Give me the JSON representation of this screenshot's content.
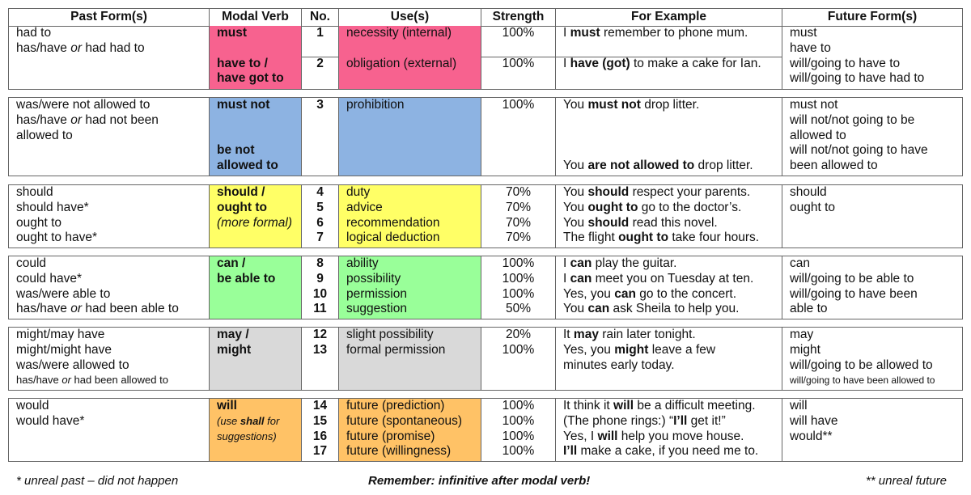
{
  "headers": [
    "Past Form(s)",
    "Modal Verb",
    "No.",
    "Use(s)",
    "Strength",
    "For Example",
    "Future Form(s)"
  ],
  "colors": {
    "must": "#f7628f",
    "must_not": "#8db3e2",
    "should": "#ffff66",
    "can": "#99ff99",
    "may": "#d9d9d9",
    "will": "#ffc266"
  },
  "groups": [
    {
      "color": "#f7628f",
      "lines": 4,
      "split_after": 2,
      "cells": {
        "past": [
          "had to",
          [
            {
              "t": "has/have "
            },
            {
              "t": "or",
              "s": "i"
            },
            {
              "t": " had had to"
            }
          ]
        ],
        "modal": [
          [
            {
              "t": "must",
              "s": "b"
            }
          ],
          "",
          [
            {
              "t": "have to /",
              "s": "b"
            }
          ],
          [
            {
              "t": "have got to",
              "s": "b"
            }
          ]
        ],
        "no": [
          [
            {
              "t": "1",
              "s": "b"
            }
          ],
          "",
          [
            {
              "t": "2",
              "s": "b"
            }
          ]
        ],
        "use": [
          "necessity (internal)",
          "",
          "obligation (external)"
        ],
        "strength": [
          "100%",
          "",
          "100%"
        ],
        "example": [
          [
            {
              "t": "I "
            },
            {
              "t": "must",
              "s": "b"
            },
            {
              "t": " remember to phone mum."
            }
          ],
          "",
          [
            {
              "t": "I "
            },
            {
              "t": "have (got)",
              "s": "b"
            },
            {
              "t": " to make a cake for Ian."
            }
          ]
        ],
        "future": [
          "must",
          "have to",
          "will/going to have to",
          "will/going to have had to"
        ]
      }
    },
    {
      "color": "#8db3e2",
      "lines": 5,
      "cells": {
        "past": [
          "was/were not allowed to",
          [
            {
              "t": "has/have "
            },
            {
              "t": "or",
              "s": "i"
            },
            {
              "t": " had not been"
            }
          ],
          "allowed to"
        ],
        "modal": [
          [
            {
              "t": "must not",
              "s": "b"
            }
          ],
          "",
          "",
          [
            {
              "t": "be not",
              "s": "b"
            }
          ],
          [
            {
              "t": "allowed to",
              "s": "b"
            }
          ]
        ],
        "no": [
          [
            {
              "t": "3",
              "s": "b"
            }
          ]
        ],
        "use": [
          "prohibition"
        ],
        "strength": [
          "100%"
        ],
        "example": [
          [
            {
              "t": "You "
            },
            {
              "t": "must not",
              "s": "b"
            },
            {
              "t": " drop litter."
            }
          ],
          "",
          "",
          "",
          [
            {
              "t": "You "
            },
            {
              "t": "are not allowed to",
              "s": "b"
            },
            {
              "t": " drop litter."
            }
          ]
        ],
        "future": [
          "must not",
          "will not/not going to be",
          "allowed to",
          "will not/not going to have",
          "been allowed to"
        ]
      }
    },
    {
      "color": "#ffff66",
      "lines": 4,
      "cells": {
        "past": [
          "should",
          "should have*",
          "ought to",
          "ought to have*"
        ],
        "modal": [
          [
            {
              "t": "should /",
              "s": "b"
            }
          ],
          [
            {
              "t": "ought to",
              "s": "b"
            }
          ],
          [
            {
              "t": "(more formal)",
              "s": "i"
            }
          ]
        ],
        "no": [
          [
            {
              "t": "4",
              "s": "b"
            }
          ],
          [
            {
              "t": "5",
              "s": "b"
            }
          ],
          [
            {
              "t": "6",
              "s": "b"
            }
          ],
          [
            {
              "t": "7",
              "s": "b"
            }
          ]
        ],
        "use": [
          "duty",
          "advice",
          "recommendation",
          "logical deduction"
        ],
        "strength": [
          "70%",
          "70%",
          "70%",
          "70%"
        ],
        "example": [
          [
            {
              "t": "You "
            },
            {
              "t": "should",
              "s": "b"
            },
            {
              "t": " respect your parents."
            }
          ],
          [
            {
              "t": "You "
            },
            {
              "t": "ought to",
              "s": "b"
            },
            {
              "t": " go to the doctor’s."
            }
          ],
          [
            {
              "t": "You "
            },
            {
              "t": "should",
              "s": "b"
            },
            {
              "t": " read this novel."
            }
          ],
          [
            {
              "t": "The flight "
            },
            {
              "t": "ought to",
              "s": "b"
            },
            {
              "t": " take four hours."
            }
          ]
        ],
        "future": [
          "should",
          "ought to"
        ]
      }
    },
    {
      "color": "#99ff99",
      "lines": 4,
      "cells": {
        "past": [
          "could",
          "could have*",
          "was/were able to",
          [
            {
              "t": "has/have "
            },
            {
              "t": "or",
              "s": "i"
            },
            {
              "t": " had been able to"
            }
          ]
        ],
        "modal": [
          [
            {
              "t": "can /",
              "s": "b"
            }
          ],
          [
            {
              "t": "be able to",
              "s": "b"
            }
          ]
        ],
        "no": [
          [
            {
              "t": "8",
              "s": "b"
            }
          ],
          [
            {
              "t": "9",
              "s": "b"
            }
          ],
          [
            {
              "t": "10",
              "s": "b"
            }
          ],
          [
            {
              "t": "11",
              "s": "b"
            }
          ]
        ],
        "use": [
          "ability",
          "possibility",
          "permission",
          "suggestion"
        ],
        "strength": [
          "100%",
          "100%",
          "100%",
          "50%"
        ],
        "example": [
          [
            {
              "t": "I "
            },
            {
              "t": "can",
              "s": "b"
            },
            {
              "t": " play the guitar."
            }
          ],
          [
            {
              "t": "I "
            },
            {
              "t": "can",
              "s": "b"
            },
            {
              "t": " meet you on Tuesday at ten."
            }
          ],
          [
            {
              "t": "Yes, you "
            },
            {
              "t": "can",
              "s": "b"
            },
            {
              "t": " go to the concert."
            }
          ],
          [
            {
              "t": "You "
            },
            {
              "t": "can",
              "s": "b"
            },
            {
              "t": " ask Sheila to help you."
            }
          ]
        ],
        "future": [
          "can",
          "will/going to be able to",
          "will/going to have been",
          "able to"
        ]
      }
    },
    {
      "color": "#d9d9d9",
      "lines": 4,
      "cells": {
        "past": [
          "might/may have",
          "might/might have",
          "was/were allowed to",
          [
            {
              "t": "has/have ",
              "s": "sm"
            },
            {
              "t": "or",
              "s": "i sm"
            },
            {
              "t": " had been allowed to",
              "s": "sm"
            }
          ]
        ],
        "modal": [
          [
            {
              "t": "may /",
              "s": "b"
            }
          ],
          [
            {
              "t": "might",
              "s": "b"
            }
          ]
        ],
        "no": [
          [
            {
              "t": "12",
              "s": "b"
            }
          ],
          [
            {
              "t": "13",
              "s": "b"
            }
          ]
        ],
        "use": [
          "slight possibility",
          "formal permission"
        ],
        "strength": [
          "20%",
          "100%"
        ],
        "example": [
          [
            {
              "t": "It "
            },
            {
              "t": "may",
              "s": "b"
            },
            {
              "t": " rain later tonight."
            }
          ],
          [
            {
              "t": "Yes, you "
            },
            {
              "t": "might",
              "s": "b"
            },
            {
              "t": " leave a few"
            }
          ],
          "minutes early today."
        ],
        "future": [
          "may",
          "might",
          "will/going to be allowed to",
          [
            {
              "t": "will/going to have been allowed to",
              "s": "xs"
            }
          ]
        ]
      }
    },
    {
      "color": "#ffc266",
      "lines": 4,
      "cells": {
        "past": [
          "would",
          "would have*"
        ],
        "modal": [
          [
            {
              "t": "will",
              "s": "b"
            }
          ],
          [
            {
              "t": "(use ",
              "s": "i sm"
            },
            {
              "t": "shall",
              "s": "bi sm"
            },
            {
              "t": " for",
              "s": "i sm"
            }
          ],
          [
            {
              "t": "suggestions)",
              "s": "i sm"
            }
          ]
        ],
        "no": [
          [
            {
              "t": "14",
              "s": "b"
            }
          ],
          [
            {
              "t": "15",
              "s": "b"
            }
          ],
          [
            {
              "t": "16",
              "s": "b"
            }
          ],
          [
            {
              "t": "17",
              "s": "b"
            }
          ]
        ],
        "use": [
          "future (prediction)",
          "future (spontaneous)",
          "future (promise)",
          "future (willingness)"
        ],
        "strength": [
          "100%",
          "100%",
          "100%",
          "100%"
        ],
        "example": [
          [
            {
              "t": "It think it "
            },
            {
              "t": "will",
              "s": "b"
            },
            {
              "t": " be a difficult meeting."
            }
          ],
          [
            {
              "t": "(The phone rings:) “"
            },
            {
              "t": "I’ll",
              "s": "b"
            },
            {
              "t": " get it!”"
            }
          ],
          [
            {
              "t": "Yes, I "
            },
            {
              "t": "will",
              "s": "b"
            },
            {
              "t": " help you move house."
            }
          ],
          [
            {
              "t": "I’ll",
              "s": "b"
            },
            {
              "t": " make a cake, if you need me to."
            }
          ]
        ],
        "future": [
          "will",
          "will have",
          "would**"
        ]
      }
    }
  ],
  "footer": {
    "left": "* unreal past – did not happen",
    "center": "Remember: infinitive after modal verb!",
    "right": "** unreal future"
  }
}
